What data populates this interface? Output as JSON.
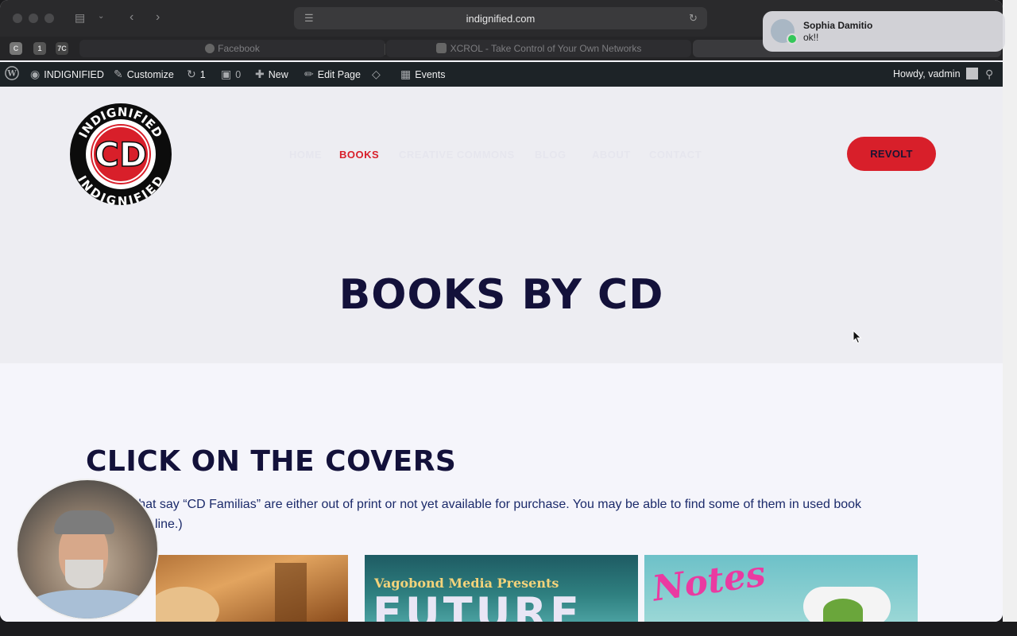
{
  "browser": {
    "url": "indignified.com",
    "tabs": [
      {
        "label": "Facebook"
      },
      {
        "label": "XCROL - Take Control of Your Own Networks"
      }
    ],
    "pinned": [
      "C",
      "1",
      "7C"
    ]
  },
  "adminbar": {
    "site_name": "INDIGNIFIED",
    "customize": "Customize",
    "updates_count": "1",
    "comments_count": "0",
    "new": "New",
    "edit_page": "Edit Page",
    "events": "Events",
    "howdy": "Howdy, vadmin"
  },
  "site": {
    "logo": {
      "top": "INDIGNIFIED",
      "center": "CD",
      "bottom": "INDIGNIFIED"
    },
    "nav": [
      {
        "label": "HOME",
        "active": false
      },
      {
        "label": "BOOKS",
        "active": true
      },
      {
        "label": "CREATIVE COMMONS",
        "active": false
      },
      {
        "label": "BLOG",
        "active": false
      },
      {
        "label": "ABOUT",
        "active": false
      },
      {
        "label": "CONTACT",
        "active": false
      }
    ],
    "cta": "REVOLT",
    "page_title": "BOOKS BY CD"
  },
  "content": {
    "heading": "CLICK ON THE COVERS",
    "paragraph_line1": "rs that say “CD Familias” are either out of print or not yet available for purchase. You may be able to find some of them in used book",
    "paragraph_line2": "line.)",
    "covers": [
      {
        "alt": "book-cover-1"
      },
      {
        "top": "Vagobond Media Presents",
        "big": "FUTURE"
      },
      {
        "title": "Notes"
      }
    ]
  },
  "notification": {
    "name": "Sophia Damitio",
    "message": "ok!!"
  },
  "colors": {
    "accent": "#d81f2a",
    "navy": "#13113a",
    "adminbar": "#1d2327"
  }
}
